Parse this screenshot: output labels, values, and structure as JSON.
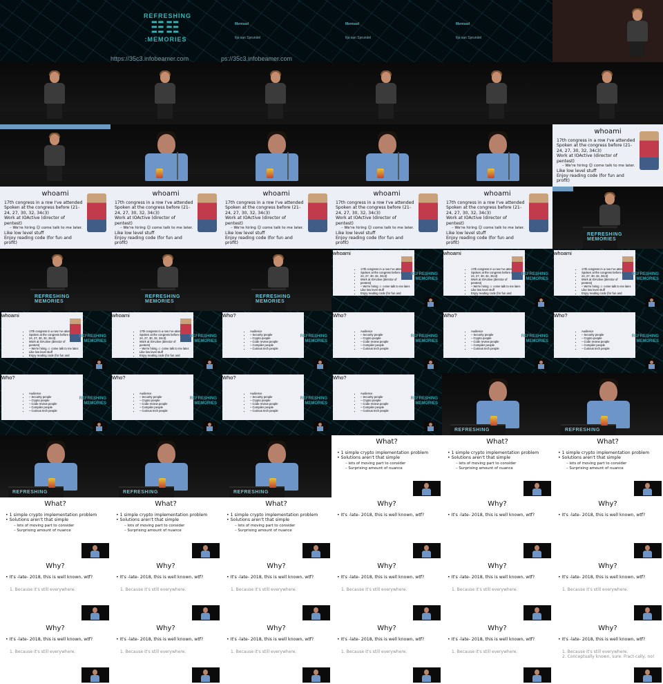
{
  "intro": {
    "logo_top": "REFRESHING",
    "logo_mark": "☷☷",
    "logo_bottom": ":MEMORIES",
    "talk_title": "Memsad",
    "speaker": "Ilja van Sprundel",
    "url": "https://35c3.infobeamer.com",
    "url_partial": "ps://35c3.infobeamer.com"
  },
  "podium_logo": [
    "REFRESHING",
    "MEMORIES"
  ],
  "podium_logo_short": "REFRESHING",
  "whoami": {
    "title": "whoami",
    "bullets": [
      "17th congress in a row I've attended",
      "Spoken at the congress before (21-",
      "24, 27, 30, 32, 34c3)",
      "Work at IOActive (director of",
      "pentest)",
      "– We're hiring ☺ come talk to me later.",
      "Like low level stuff",
      "Enjoy reading code (for fun and",
      "profit)"
    ]
  },
  "who": {
    "title": "Who?",
    "col1": [
      "Audience",
      "– Security people",
      "– Crypto people",
      "– Code review people",
      "– Compiler people",
      "– Curious tech people"
    ],
    "col2": [
      "Knowledge level",
      "– Basic will do",
      "• Some C required",
      "– More advanced",
      "• As slides move on"
    ]
  },
  "what": {
    "title": "What?",
    "bullets": [
      "1 simple crypto implementation problem",
      "Solutions aren't that simple"
    ],
    "sub": [
      "– lots of moving part to consider",
      "– Surprising amount of nuance"
    ]
  },
  "why": {
    "title": "Why?",
    "bullet": "It's -late- 2018, this is well known, wtf?",
    "point1": "1.  Because it's still everywhere.",
    "point2": "2.  Conceptually known, sure. Fract-cally, no!"
  }
}
